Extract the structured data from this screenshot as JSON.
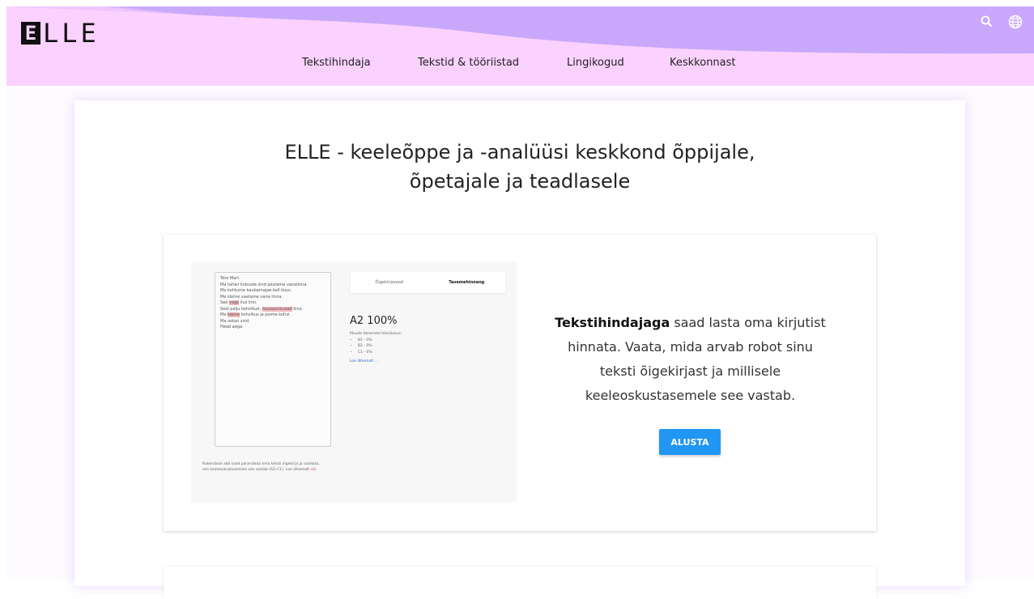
{
  "header": {
    "logo_box": "E",
    "logo_rest": "LLE",
    "nav": [
      {
        "label": "Tekstihindaja"
      },
      {
        "label": "Tekstid & tööriistad"
      },
      {
        "label": "Lingikogud"
      },
      {
        "label": "Keskkonnast"
      }
    ],
    "icons": [
      "search-icon",
      "globe-icon"
    ],
    "colors": {
      "background": "#fbd2ff",
      "wave": "#c9a8fb"
    }
  },
  "main": {
    "headline_line1": "ELLE - keeleõppe ja -analüüsi keskkond õppijale,",
    "headline_line2": "õpetajale ja teadlasele"
  },
  "feature": {
    "preview": {
      "text_lines": [
        "Tere Mari.",
        "Ma tahan kutsuda sind jalutama vanalinna.",
        "Me kohtume kaubamajae kell kuus.",
        "Me käime vaatame vana linna.",
        "See",
        "vaga",
        "ilus linn.",
        "Seal palju kohvikud,",
        "muuseumused",
        "kino.",
        "Me",
        "käime",
        "kohvikus ja joome kohvi.",
        "Ma ootan sind.",
        "Head aega."
      ],
      "tab_inactive": "Õigekirjavead",
      "tab_active": "Tasemehinnang",
      "level": "A2 100%",
      "level_intro": "Muude tasemete tõenäosus:",
      "level_items": [
        "B1 - 0%",
        "B2 - 0%",
        "C1 - 0%"
      ],
      "level_more": "Loe lähemalt ...",
      "caption": "Rakenduse abil saad parandada oma teksti õigekirja ja vaadata, mis keeleoskustasemele see vastab (A2–C1). Loe lähemalt",
      "caption_link": "siit"
    },
    "text_bold": "Tekstihindajaga",
    "text_rest": "saad lasta oma kirjutist hinnata. Vaata, mida arvab robot sinu teksti õigekirjast ja millisele keeleoskustasemele see vastab.",
    "button_label": "ALUSTA",
    "button_color": "#2196f3"
  }
}
